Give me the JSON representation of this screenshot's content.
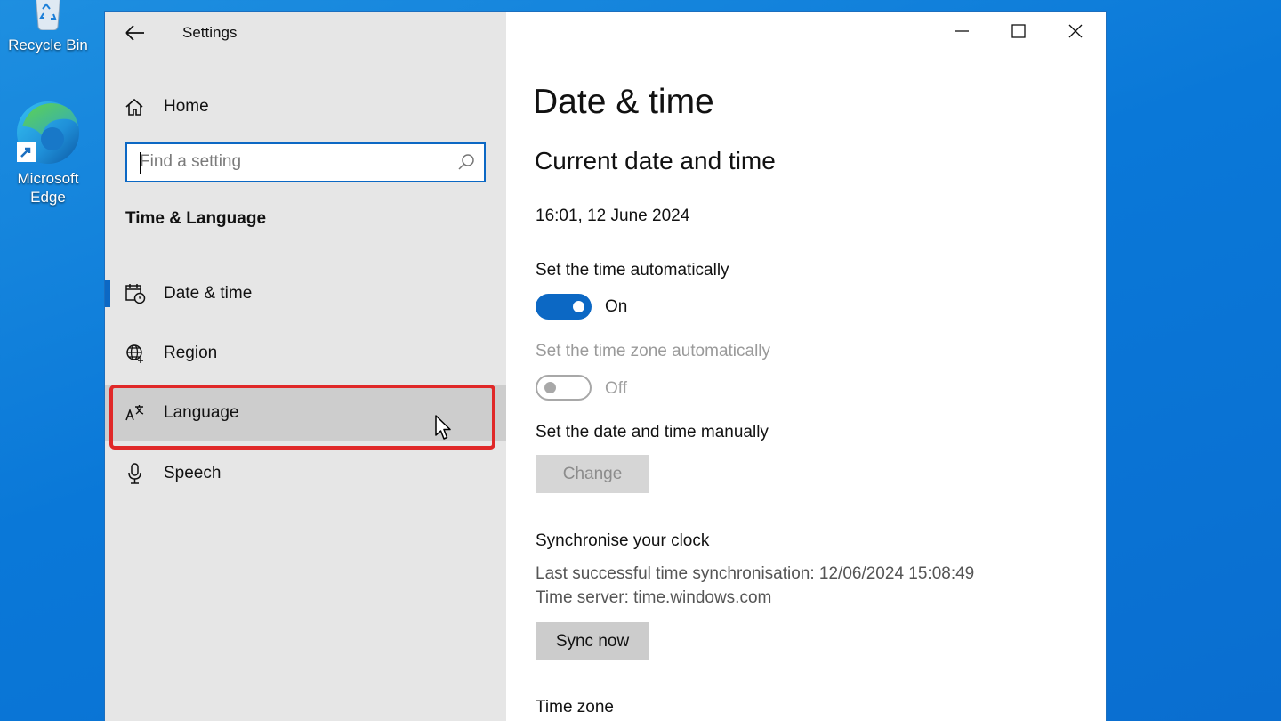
{
  "desktop": {
    "icons": [
      {
        "label": "Recycle Bin",
        "icon": "recycle-bin-icon"
      },
      {
        "label": "Microsoft\nEdge",
        "label_line1": "Microsoft",
        "label_line2": "Edge",
        "icon": "edge-icon"
      }
    ]
  },
  "window": {
    "title": "Settings",
    "controls": {
      "minimize": "minimize-icon",
      "maximize": "maximize-icon",
      "close": "close-icon"
    }
  },
  "sidebar": {
    "home_label": "Home",
    "search_placeholder": "Find a setting",
    "section_title": "Time & Language",
    "items": [
      {
        "label": "Date & time",
        "icon": "calendar-clock-icon",
        "selected": true
      },
      {
        "label": "Region",
        "icon": "globe-icon"
      },
      {
        "label": "Language",
        "icon": "language-icon",
        "hovered": true
      },
      {
        "label": "Speech",
        "icon": "microphone-icon"
      }
    ]
  },
  "main": {
    "page_title": "Date & time",
    "section_title": "Current date and time",
    "current_datetime": "16:01, 12 June 2024",
    "auto_time": {
      "label": "Set the time automatically",
      "state": "On"
    },
    "auto_timezone": {
      "label": "Set the time zone automatically",
      "state": "Off"
    },
    "manual": {
      "label": "Set the date and time manually",
      "button": "Change"
    },
    "sync": {
      "heading": "Synchronise your clock",
      "last_sync": "Last successful time synchronisation: 12/06/2024 15:08:49",
      "server": "Time server: time.windows.com",
      "button": "Sync now"
    },
    "timezone_heading": "Time zone"
  },
  "colors": {
    "accent": "#0c68c4",
    "highlight": "#e02828",
    "sidebar_bg": "#e6e6e6"
  }
}
